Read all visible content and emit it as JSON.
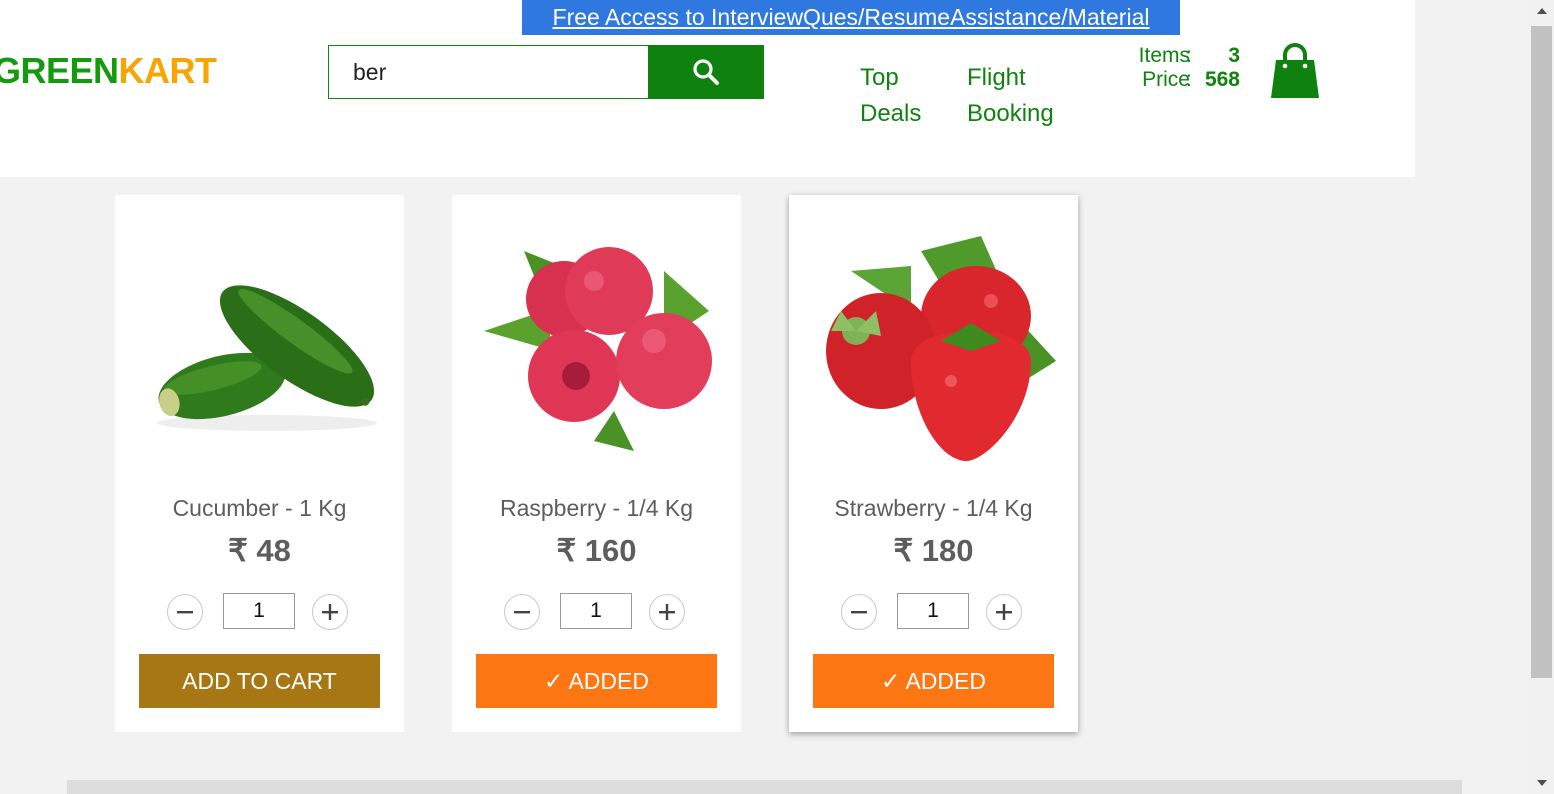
{
  "promo": {
    "text": "Free Access to InterviewQues/ResumeAssistance/Material"
  },
  "brand": {
    "part1": "GREEN",
    "part2": "KART",
    "color1": "#149a0e",
    "color2": "#f8a402"
  },
  "search": {
    "value": "ber",
    "icon": "search-icon"
  },
  "nav": {
    "top_deals_1": "Top",
    "top_deals_2": "Deals",
    "flight_1": "Flight",
    "flight_2": "Booking"
  },
  "cart": {
    "items_label": "Items",
    "items_value": "3",
    "price_label": "Price",
    "price_value": "568",
    "separator": ":",
    "icon": "shopping-bag-icon"
  },
  "products": [
    {
      "name": "Cucumber - 1 Kg",
      "price": "₹ 48",
      "qty": "1",
      "button": "ADD TO CART",
      "image": "cucumber"
    },
    {
      "name": "Raspberry - 1/4 Kg",
      "price": "₹ 160",
      "qty": "1",
      "button": "✓ ADDED",
      "image": "raspberry"
    },
    {
      "name": "Strawberry - 1/4 Kg",
      "price": "₹ 180",
      "qty": "1",
      "button": "✓ ADDED",
      "image": "strawberry"
    }
  ],
  "colors": {
    "accent": "#0e810e",
    "add_button": "#a67714",
    "added_button": "#fd7614",
    "promo": "#2f78df"
  }
}
